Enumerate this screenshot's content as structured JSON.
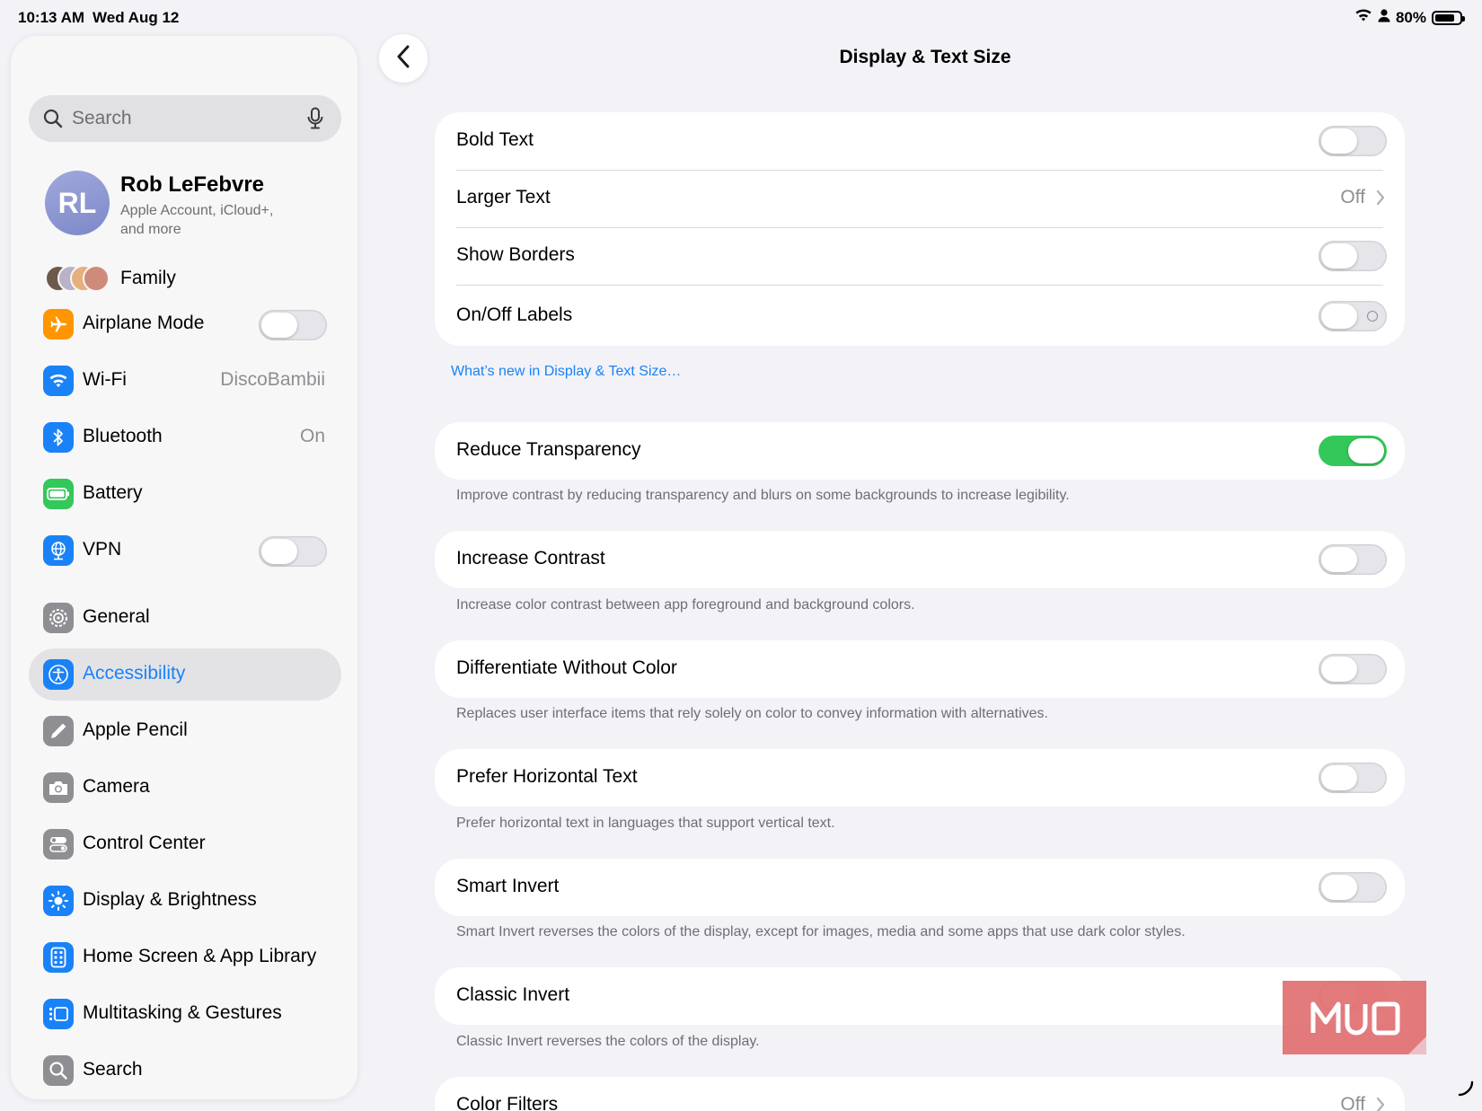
{
  "status": {
    "time": "10:13 AM",
    "date": "Wed Aug 12",
    "battery": "80%",
    "battery_level": 0.8
  },
  "search": {
    "placeholder": "Search"
  },
  "profile": {
    "initials": "RL",
    "name": "Rob LeFebvre",
    "subtitle": "Apple Account, iCloud+, and more"
  },
  "family": {
    "label": "Family"
  },
  "sidebar": {
    "items": [
      {
        "label": "Airplane Mode",
        "icon": "airplane-icon",
        "color": "#ff9500",
        "toggle": false
      },
      {
        "label": "Wi-Fi",
        "icon": "wifi-icon",
        "color": "#1a82f7",
        "value": "DiscoBambii"
      },
      {
        "label": "Bluetooth",
        "icon": "bluetooth-icon",
        "color": "#1a82f7",
        "value": "On"
      },
      {
        "label": "Battery",
        "icon": "battery-icon",
        "color": "#34c759"
      },
      {
        "label": "VPN",
        "icon": "vpn-globe-icon",
        "color": "#1a82f7",
        "toggle": false
      },
      {
        "label": "General",
        "icon": "gear-icon",
        "color": "#8e8e93"
      },
      {
        "label": "Accessibility",
        "icon": "accessibility-icon",
        "color": "#1a82f7",
        "selected": true
      },
      {
        "label": "Apple Pencil",
        "icon": "pencil-icon",
        "color": "#8e8e93"
      },
      {
        "label": "Camera",
        "icon": "camera-icon",
        "color": "#8e8e93"
      },
      {
        "label": "Control Center",
        "icon": "control-center-icon",
        "color": "#8e8e93"
      },
      {
        "label": "Display & Brightness",
        "icon": "sun-icon",
        "color": "#1a82f7"
      },
      {
        "label": "Home Screen & App Library",
        "icon": "home-screen-icon",
        "color": "#1a82f7"
      },
      {
        "label": "Multitasking & Gestures",
        "icon": "multitasking-icon",
        "color": "#1a82f7"
      },
      {
        "label": "Search",
        "icon": "search-icon",
        "color": "#8e8e93"
      }
    ]
  },
  "main": {
    "title": "Display & Text Size",
    "group1": [
      {
        "label": "Bold Text",
        "toggle": false
      },
      {
        "label": "Larger Text",
        "value": "Off"
      },
      {
        "label": "Show Borders",
        "toggle": false
      },
      {
        "label": "On/Off Labels",
        "toggle": false
      }
    ],
    "whats_new_link": "What’s new in Display & Text Size…",
    "settings": [
      {
        "label": "Reduce Transparency",
        "toggle": true,
        "footnote": "Improve contrast by reducing transparency and blurs on some backgrounds to increase legibility."
      },
      {
        "label": "Increase Contrast",
        "toggle": false,
        "footnote": "Increase color contrast between app foreground and background colors."
      },
      {
        "label": "Differentiate Without Color",
        "toggle": false,
        "footnote": "Replaces user interface items that rely solely on color to convey information with alternatives."
      },
      {
        "label": "Prefer Horizontal Text",
        "toggle": false,
        "footnote": "Prefer horizontal text in languages that support vertical text."
      },
      {
        "label": "Smart Invert",
        "toggle": false,
        "footnote": "Smart Invert reverses the colors of the display, except for images, media and some apps that use dark color styles."
      },
      {
        "label": "Classic Invert",
        "toggle": false,
        "footnote": "Classic Invert reverses the colors of the display."
      },
      {
        "label": "Color Filters",
        "value": "Off"
      }
    ]
  },
  "watermark": {
    "text": "MUO",
    "color": "#e27375"
  },
  "colors": {
    "accent": "#1a82f7",
    "toggle_on": "#34c759",
    "background": "#f2f2f7"
  }
}
